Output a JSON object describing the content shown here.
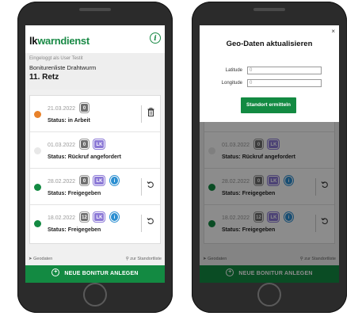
{
  "app": {
    "logo_part1": "lk",
    "logo_part2": "warndienst",
    "info_icon": "info-icon",
    "login_label": "Eingeloggt als User Testit",
    "list_name": "Boniturenliste Drahtwurm",
    "location": "11. Retz"
  },
  "cards": [
    {
      "date": "21.03.2022",
      "badges": [
        "0"
      ],
      "status_label": "Status:",
      "status_value": "in Arbeit",
      "dot_color": "#e8822a",
      "action_icon": "trash-icon"
    },
    {
      "date": "01.03.2022",
      "badges": [
        "0",
        "LK"
      ],
      "status_label": "Status:",
      "status_value": "Rückruf angefordert",
      "dot_color": "#e8e8e8",
      "action_icon": ""
    },
    {
      "date": "28.02.2022",
      "badges": [
        "0",
        "LK",
        "i"
      ],
      "status_label": "Status:",
      "status_value": "Freigegeben",
      "dot_color": "#138a42",
      "action_icon": "undo-icon"
    },
    {
      "date": "18.02.2022",
      "badges": [
        "12",
        "LK",
        "i"
      ],
      "status_label": "Status:",
      "status_value": "Freigegeben",
      "dot_color": "#138a42",
      "action_icon": "undo-icon"
    }
  ],
  "footer": {
    "left_label": "Geodaten",
    "right_label": "zur Standortliste"
  },
  "new_button": {
    "label": "NEUE BONITUR ANLEGEN"
  },
  "modal": {
    "close": "×",
    "title": "Geo-Daten aktualisieren",
    "latitude_label": "Latitude",
    "latitude_value": "0",
    "longitude_label": "Longitude",
    "longitude_value": "0",
    "button_label": "Standort ermitteln"
  },
  "colors": {
    "brand_green": "#138a42",
    "orange": "#e8822a",
    "purple_badge": "#8b78d6",
    "blue_badge": "#2c8fd1"
  }
}
